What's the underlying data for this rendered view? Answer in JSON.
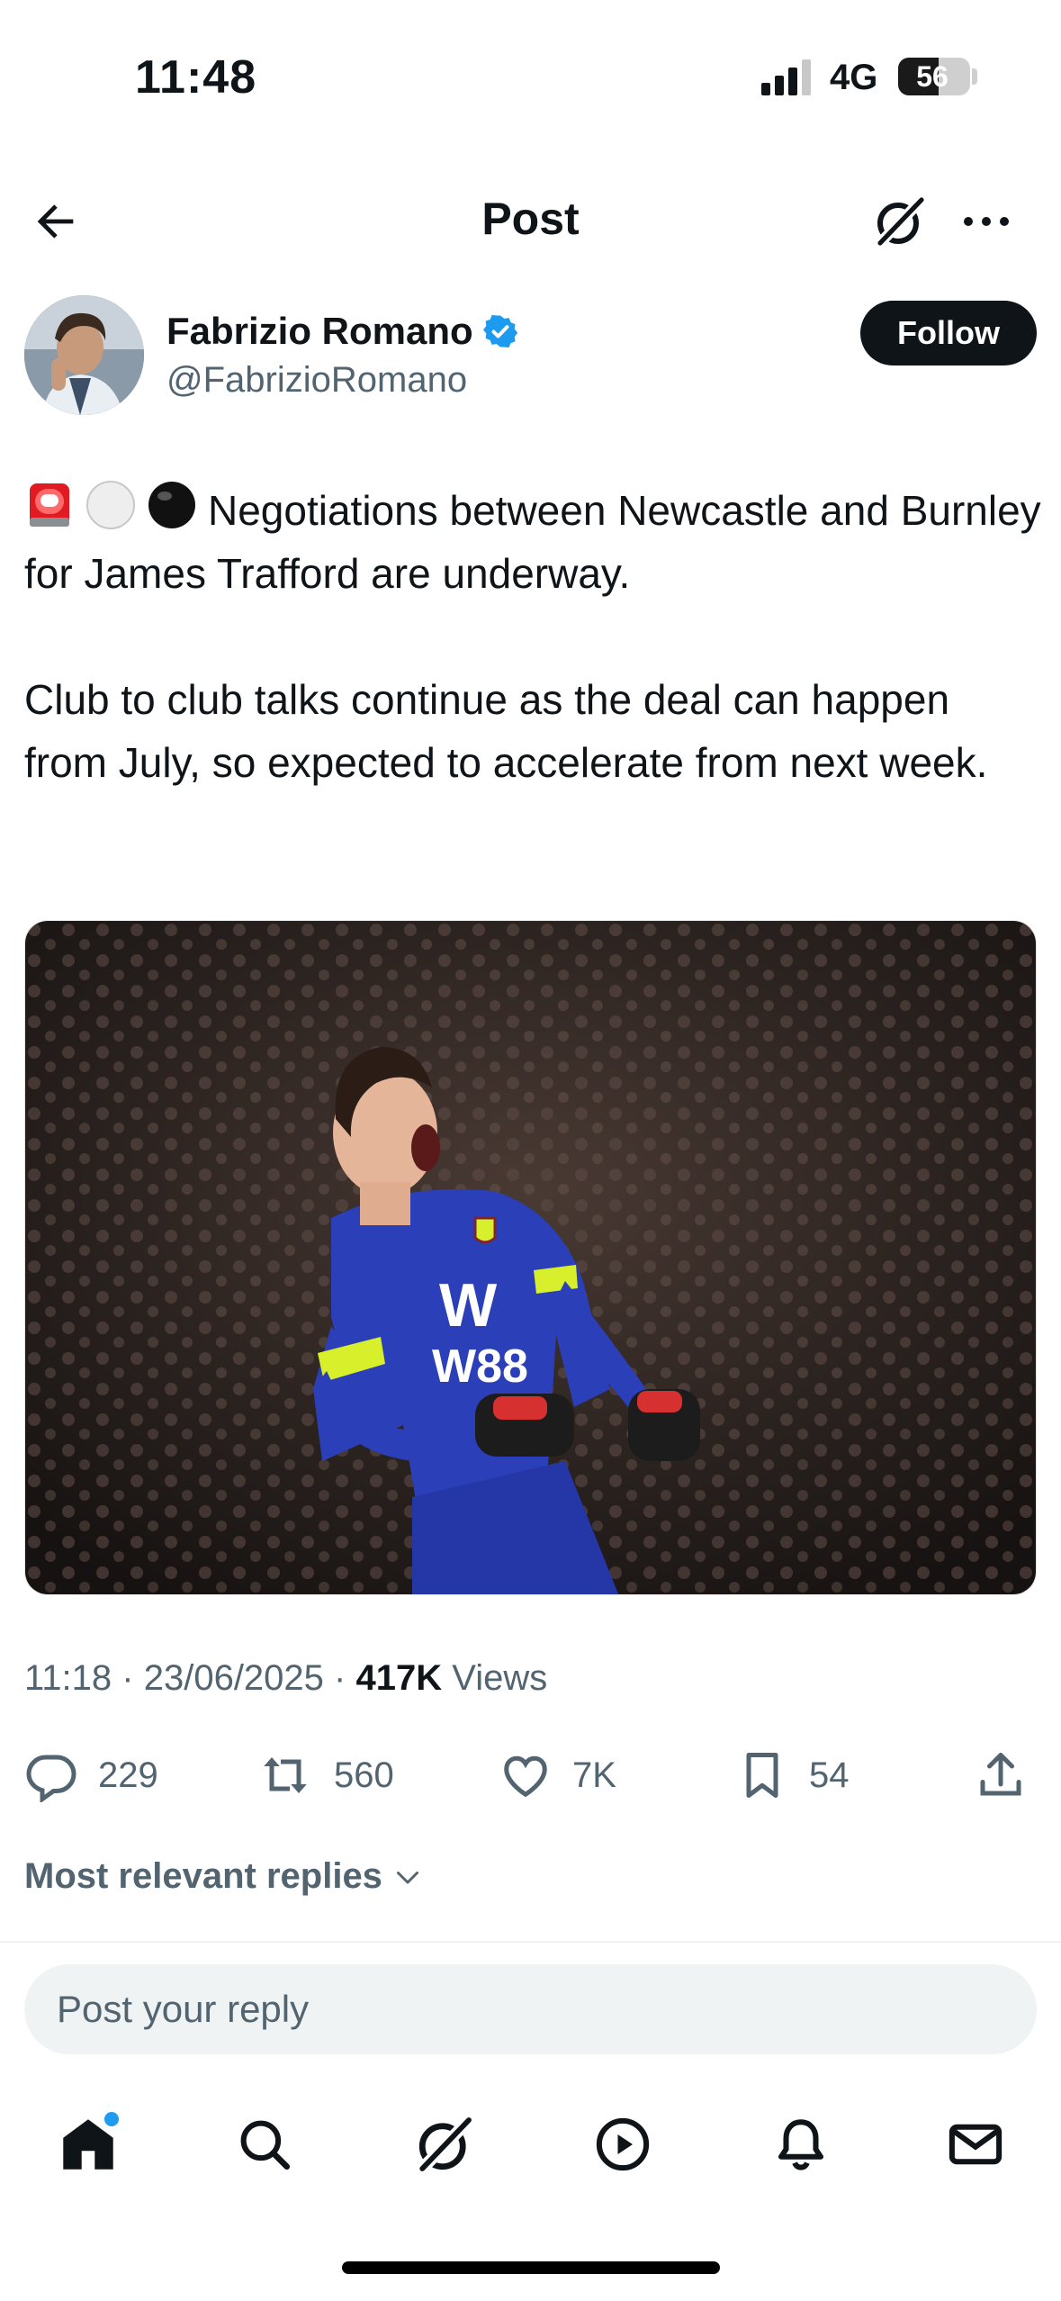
{
  "status_bar": {
    "time": "11:48",
    "network": "4G",
    "battery_level": "56",
    "battery_fraction": 0.56
  },
  "header": {
    "title": "Post"
  },
  "author": {
    "name": "Fabrizio Romano",
    "handle": "@FabrizioRomano",
    "verified": true,
    "follow_label": "Follow"
  },
  "post": {
    "paragraph1": "Negotiations between Newcastle and Burnley for James Trafford are underway.",
    "paragraph2": "Club to club talks continue as the deal can happen from July, so expected to accelerate from next week.",
    "emojis": [
      "siren-emoji",
      "white-circle-emoji",
      "black-circle-emoji"
    ]
  },
  "meta": {
    "time": "11:18",
    "date": "23/06/2025",
    "views_count": "417K",
    "views_label": "Views",
    "separator": "·"
  },
  "actions": {
    "replies": "229",
    "reposts": "560",
    "likes": "7K",
    "bookmarks": "54"
  },
  "replies_sort": {
    "label": "Most relevant replies"
  },
  "reply_box": {
    "placeholder": "Post your reply"
  },
  "tabs": [
    "home-icon",
    "search-icon",
    "grok-icon",
    "video-icon",
    "notifications-icon",
    "messages-icon"
  ],
  "colors": {
    "accent": "#1d9bf0",
    "text": "#0f1419",
    "muted": "#536471",
    "kit_blue": "#2a3fb8",
    "kit_yellow": "#d8ef2b"
  }
}
